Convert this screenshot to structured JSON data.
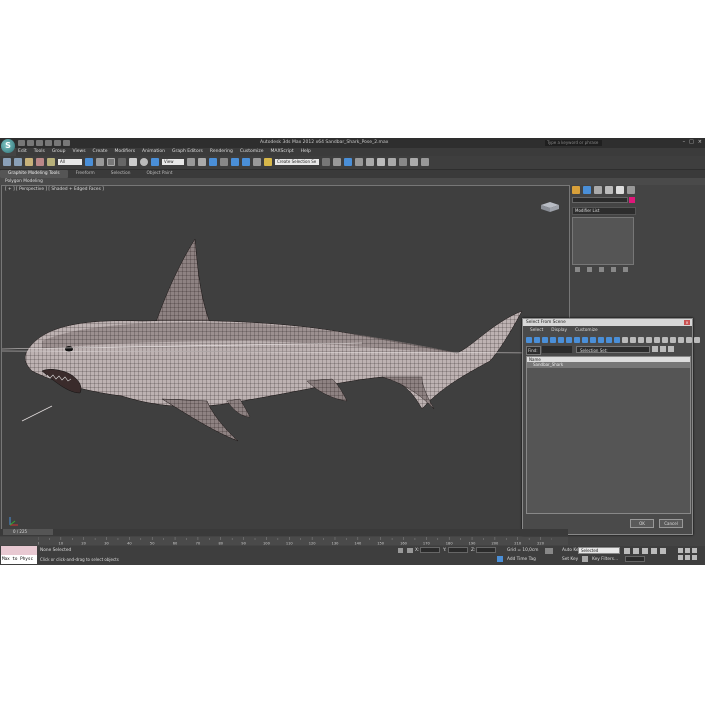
{
  "app": {
    "logo_letter": "S",
    "title": "Autodesk 3ds Max  2012 x64     Sandbar_Shark_Pose_2.max",
    "search_placeholder": "Type a keyword or phrase",
    "window_buttons": [
      "–",
      "□",
      "×"
    ]
  },
  "menu": [
    "Edit",
    "Tools",
    "Group",
    "Views",
    "Create",
    "Modifiers",
    "Animation",
    "Graph Editors",
    "Rendering",
    "Customize",
    "MAXScript",
    "Help"
  ],
  "toolbar": {
    "selection_filter": "All",
    "ref_coord": "View",
    "named_selection": "Create Selection Se"
  },
  "ribbon": {
    "tabs": [
      "Graphite Modeling Tools",
      "Freeform",
      "Selection",
      "Object Paint"
    ],
    "active_tab": 0,
    "sub_label": "Polygon Modeling"
  },
  "viewport": {
    "label": "[ + ] [ Perspective ] [ Shaded + Edged Faces ]",
    "background": "#3f3f3f"
  },
  "command_panel": {
    "modifier_list": "Modifier List",
    "swatch_color": "#e0177a"
  },
  "dialog": {
    "title": "Select From Scene",
    "close": "×",
    "menu": [
      "Select",
      "Display",
      "Customize"
    ],
    "find_label": "Find:",
    "selection_set": "Selection Set:",
    "list_header": "Name",
    "items": [
      "Sandbar_Shark"
    ],
    "ok": "OK",
    "cancel": "Cancel"
  },
  "timeline": {
    "slider": "0 / 225",
    "ticks": [
      "0",
      "10",
      "20",
      "30",
      "40",
      "50",
      "60",
      "70",
      "80",
      "90",
      "100",
      "110",
      "120",
      "130",
      "140",
      "150",
      "160",
      "170",
      "180",
      "190",
      "200",
      "210",
      "220"
    ]
  },
  "status": {
    "maxscript": "Max to Physc",
    "selection": "None Selected",
    "prompt": "Click or click-and-drag to select objects",
    "x_label": "X:",
    "y_label": "Y:",
    "z_label": "Z:",
    "grid": "Grid = 10,0cm",
    "add_time_tag": "Add Time Tag",
    "auto_key": "Auto Key",
    "auto_key_value": "Selected",
    "set_key": "Set Key",
    "key_filters": "Key Filters..."
  }
}
